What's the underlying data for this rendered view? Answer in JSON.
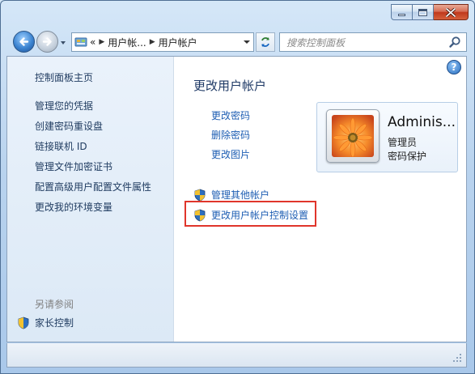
{
  "window": {
    "caption": {
      "min_icon": "minimize-icon",
      "max_icon": "maximize-icon",
      "close_icon": "close-icon"
    }
  },
  "navbar": {
    "address": {
      "seg_root": "«",
      "seg1": "用户帐...",
      "seg2": "用户帐户"
    },
    "search_placeholder": "搜索控制面板"
  },
  "sidebar": {
    "home": "控制面板主页",
    "items": [
      {
        "label": "管理您的凭据"
      },
      {
        "label": "创建密码重设盘"
      },
      {
        "label": "链接联机 ID"
      },
      {
        "label": "管理文件加密证书"
      },
      {
        "label": "配置高级用户配置文件属性"
      },
      {
        "label": "更改我的环境变量"
      }
    ],
    "see_also": "另请参阅",
    "parental": "家长控制"
  },
  "main": {
    "title": "更改用户帐户",
    "tasks": [
      {
        "label": "更改密码"
      },
      {
        "label": "删除密码"
      },
      {
        "label": "更改图片"
      }
    ],
    "admin_tasks": [
      {
        "label": "管理其他帐户"
      },
      {
        "label": "更改用户帐户控制设置"
      }
    ],
    "help": "?"
  },
  "user": {
    "name": "Adminis...",
    "role": "管理员",
    "password_state": "密码保护"
  },
  "colors": {
    "highlight": "#e0352b",
    "link": "#1e5eb3"
  }
}
